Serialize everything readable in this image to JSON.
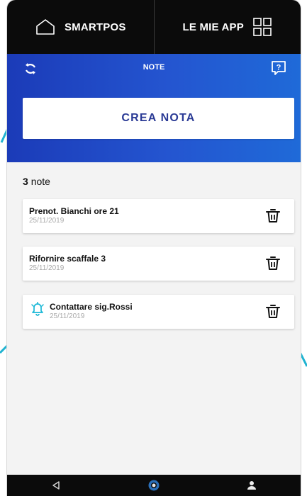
{
  "topbar": {
    "home_label": "SMARTPOS",
    "apps_label": "LE MIE APP"
  },
  "header": {
    "title": "NOTE",
    "help_glyph": "?"
  },
  "create_button": {
    "label": "CREA NOTA"
  },
  "notes_count": {
    "number": "3",
    "word": "note"
  },
  "notes": [
    {
      "title": "Prenot. Bianchi ore 21",
      "date": "25/11/2019",
      "has_reminder": false
    },
    {
      "title": "Rifornire scaffale 3",
      "date": "25/11/2019",
      "has_reminder": false
    },
    {
      "title": "Contattare sig.Rossi",
      "date": "25/11/2019",
      "has_reminder": true
    }
  ],
  "icons": {
    "home": "home-icon",
    "apps": "apps-grid-icon",
    "refresh": "refresh-icon",
    "help": "help-icon",
    "trash": "trash-icon",
    "bell": "bell-icon",
    "back": "back-icon",
    "home_nav": "home-circle-icon",
    "profile": "person-icon"
  },
  "colors": {
    "accent_blue": "#2455d0",
    "button_text": "#2a3a95",
    "bell_cyan": "#1ab8d6",
    "callout_cyan": "#1fb3d1"
  }
}
